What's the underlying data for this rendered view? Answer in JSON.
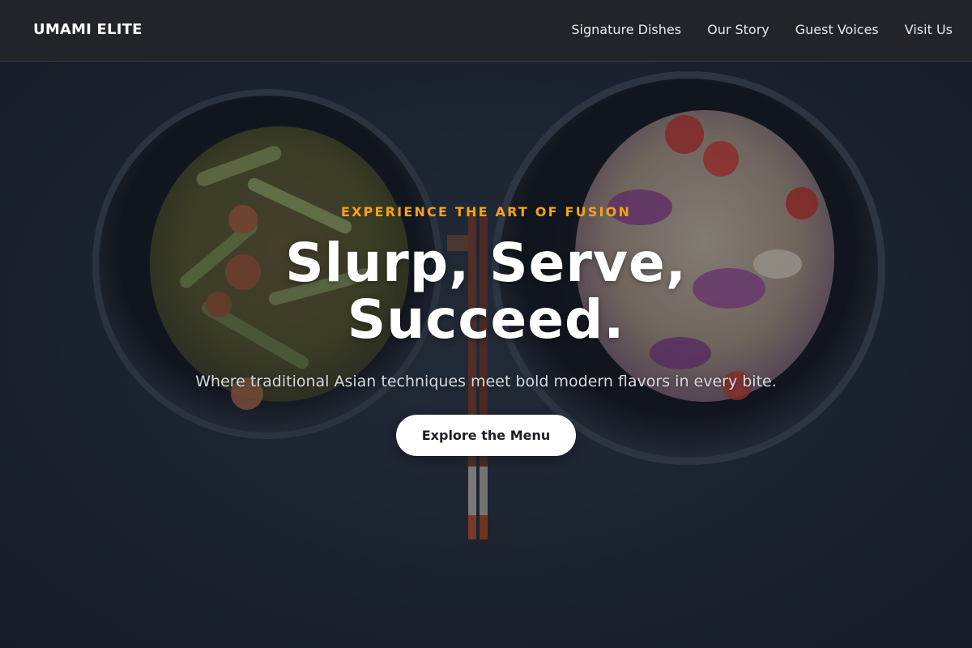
{
  "brand": {
    "name": "UMAMI ELITE"
  },
  "nav": {
    "links": [
      {
        "label": "Signature Dishes"
      },
      {
        "label": "Our Story"
      },
      {
        "label": "Guest Voices"
      },
      {
        "label": "Visit Us"
      }
    ]
  },
  "hero": {
    "eyebrow": "EXPERIENCE THE ART OF FUSION",
    "headline": "Slurp, Serve, Succeed.",
    "subtitle": "Where traditional Asian techniques meet bold modern flavors in every bite.",
    "cta_label": "Explore the Menu",
    "image": "two-bowls-with-stir-fry-and-salad-and-chopsticks"
  },
  "colors": {
    "nav_bg": "#212428",
    "accent": "#f5a21a",
    "hero_bg": "#1f2836",
    "cta_bg": "#ffffff",
    "cta_text": "#1b1f24",
    "text_light": "#ffffff"
  }
}
